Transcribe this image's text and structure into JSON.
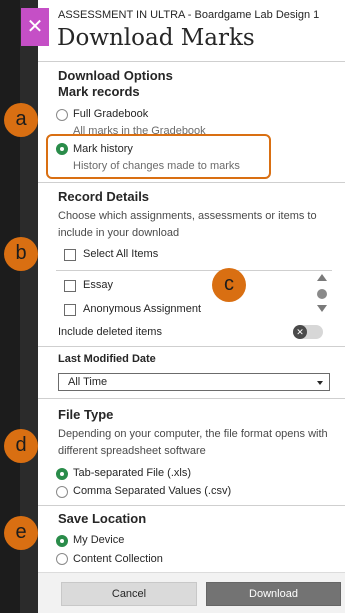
{
  "header": {
    "course_name": "ASSESSMENT IN ULTRA - Boardgame Lab Design 1",
    "title": "Download Marks",
    "close_symbol": "✕"
  },
  "download_options": {
    "title": "Download Options",
    "mark_records_label": "Mark records",
    "options": [
      {
        "label": "Full Gradebook",
        "description": "All marks in the Gradebook",
        "selected": false
      },
      {
        "label": "Mark history",
        "description": "History of changes made to marks",
        "selected": true
      }
    ]
  },
  "record_details": {
    "title": "Record Details",
    "description": "Choose which assignments, assessments or items to include in your download",
    "select_all_label": "Select All Items",
    "items": [
      "Essay",
      "Anonymous Assignment"
    ],
    "include_deleted_label": "Include deleted items",
    "toggle_symbol": "✕"
  },
  "last_modified": {
    "label": "Last Modified Date",
    "selected": "All Time"
  },
  "file_type": {
    "title": "File Type",
    "description": "Depending on your computer, the file format opens with different spreadsheet software",
    "options": [
      {
        "label": "Tab-separated File (.xls)",
        "selected": true
      },
      {
        "label": "Comma Separated Values (.csv)",
        "selected": false
      }
    ]
  },
  "save_location": {
    "title": "Save Location",
    "options": [
      {
        "label": "My Device",
        "selected": true
      },
      {
        "label": "Content Collection",
        "selected": false
      }
    ]
  },
  "footer": {
    "cancel_label": "Cancel",
    "download_label": "Download"
  },
  "markers": [
    "a",
    "b",
    "c",
    "d",
    "e"
  ],
  "colors": {
    "accent_green": "#2a8c4a",
    "marker_orange": "#d96f12",
    "close_purple": "#c54fc6"
  }
}
